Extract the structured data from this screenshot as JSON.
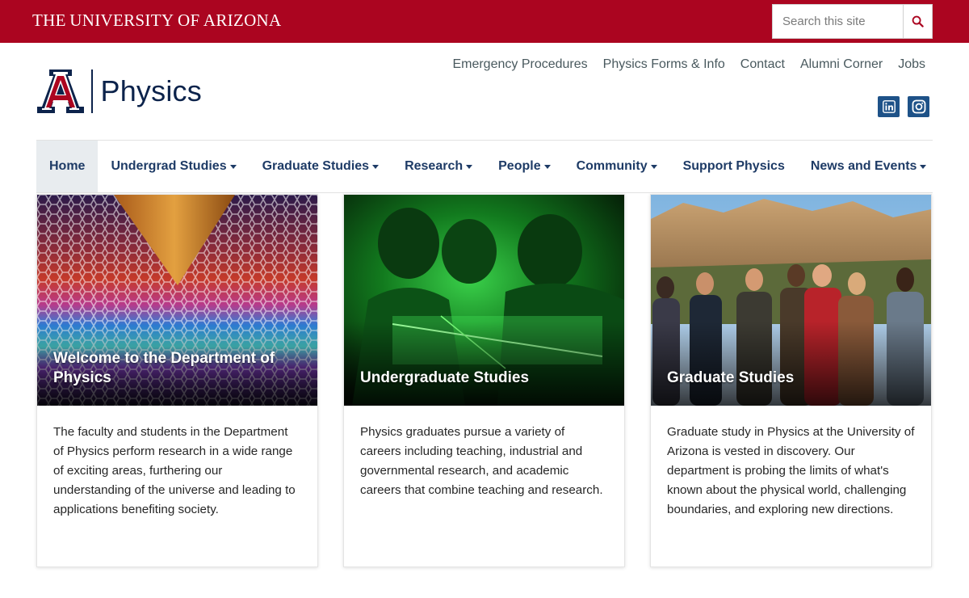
{
  "topbar": {
    "wordmark_prefix": "The",
    "wordmark_main": "University of Arizona",
    "search_placeholder": "Search this site",
    "brand_color": "#ab0520"
  },
  "header": {
    "logo_text": "Physics",
    "utility_links": [
      {
        "label": "Emergency Procedures"
      },
      {
        "label": "Physics Forms & Info"
      },
      {
        "label": "Contact"
      },
      {
        "label": "Alumni Corner"
      },
      {
        "label": "Jobs"
      }
    ],
    "social": [
      {
        "icon": "linkedin-icon"
      },
      {
        "icon": "instagram-icon"
      }
    ]
  },
  "nav": {
    "items": [
      {
        "label": "Home",
        "active": true,
        "dropdown": false
      },
      {
        "label": "Undergrad Studies",
        "active": false,
        "dropdown": true
      },
      {
        "label": "Graduate Studies",
        "active": false,
        "dropdown": true
      },
      {
        "label": "Research",
        "active": false,
        "dropdown": true
      },
      {
        "label": "People",
        "active": false,
        "dropdown": true
      },
      {
        "label": "Community",
        "active": false,
        "dropdown": true
      },
      {
        "label": "Support Physics",
        "active": false,
        "dropdown": false
      },
      {
        "label": "News and Events",
        "active": false,
        "dropdown": true
      }
    ]
  },
  "cards": [
    {
      "title": "Welcome to the Department of Physics",
      "body": "The faculty and students in the Department of Physics perform research in a wide range of exciting areas, furthering our understanding of the universe and leading to applications benefiting society."
    },
    {
      "title": "Undergraduate Studies",
      "body": "Physics graduates pursue a variety of careers including teaching, industrial and governmental research, and academic careers that combine teaching and research."
    },
    {
      "title": "Graduate Studies",
      "body": "Graduate study in Physics at the University of Arizona is vested in discovery. Our department is probing the limits of what's known about the physical world, challenging boundaries, and exploring new directions."
    }
  ]
}
